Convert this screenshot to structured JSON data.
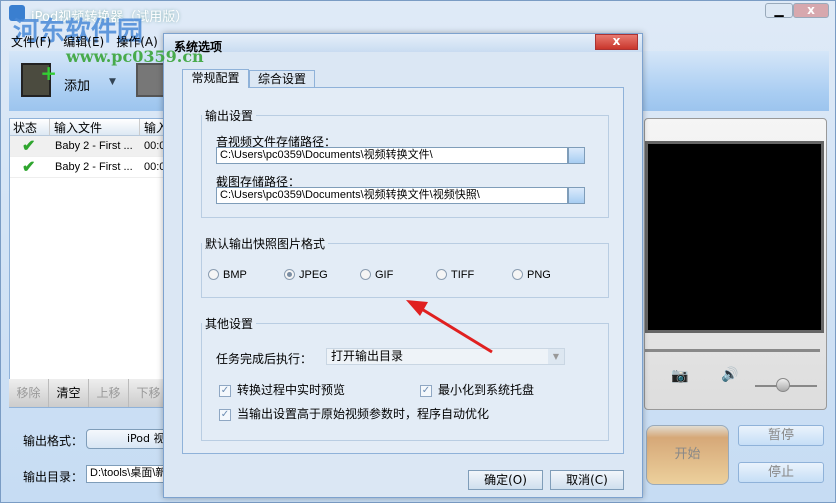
{
  "window": {
    "title": "iPod视频转换器（试用版）",
    "watermark_name": "河东软件园",
    "watermark_url": "www.pc0359.cn"
  },
  "menu": [
    "文件(F)",
    "编辑(E)",
    "操作(A)"
  ],
  "toolbar": {
    "add_label": "添加"
  },
  "file_list": {
    "headers": [
      "状态",
      "输入文件",
      "输入"
    ],
    "rows": [
      {
        "status": "done",
        "file": "Baby 2 - First ...",
        "duration": "00:0"
      },
      {
        "status": "done",
        "file": "Baby 2 - First ...",
        "duration": "00:0"
      }
    ],
    "buttons": [
      "移除",
      "清空",
      "上移",
      "下移"
    ]
  },
  "bottom": {
    "format_label": "输出格式：",
    "format_value": "iPod 视频",
    "dir_label": "输出目录：",
    "dir_value": "D:\\tools\\桌面\\新"
  },
  "actions": {
    "start": "开始",
    "pause": "暂停",
    "stop": "停止"
  },
  "player": {
    "volume": 0.45
  },
  "dialog": {
    "title": "系统选项",
    "tabs": [
      "常规配置",
      "综合设置"
    ],
    "active_tab": 0,
    "output_group": "输出设置",
    "av_path_label": "音视频文件存储路径：",
    "av_path": "C:\\Users\\pc0359\\Documents\\视频转换文件\\",
    "shot_path_label": "截图存储路径：",
    "shot_path": "C:\\Users\\pc0359\\Documents\\视频转换文件\\视频快照\\",
    "format_group": "默认输出快照图片格式",
    "formats": [
      "BMP",
      "JPEG",
      "GIF",
      "TIFF",
      "PNG"
    ],
    "selected_format": "JPEG",
    "other_group": "其他设置",
    "after_label": "任务完成后执行：",
    "after_value": "打开输出目录",
    "checks": [
      {
        "label": "转换过程中实时预览",
        "checked": true
      },
      {
        "label": "最小化到系统托盘",
        "checked": true
      },
      {
        "label": "当输出设置高于原始视频参数时，程序自动优化",
        "checked": true
      }
    ],
    "ok": "确定(O)",
    "cancel": "取消(C)"
  },
  "colors": {
    "annotation_arrow": "#e02020",
    "close_red": "#d9463f"
  }
}
